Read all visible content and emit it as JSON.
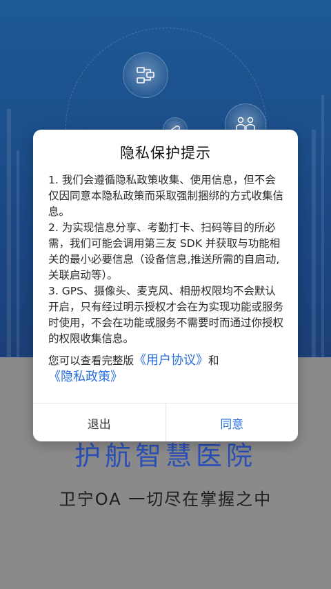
{
  "app": {
    "hospital_name": "护航智慧医院",
    "slogan": "卫宁OA  一切尽在掌握之中"
  },
  "icons": {
    "top_bubble": "workflow-icon",
    "right_bubble": "people-icon",
    "small_bubble": "capsule-icon"
  },
  "dialog": {
    "title": "隐私保护提示",
    "paragraphs": [
      "1. 我们会遵循隐私政策收集、使用信息，但不会仅因同意本隐私政策而采取强制捆绑的方式收集信息。",
      "2. 为实现信息分享、考勤打卡、扫码等目的所必需，我们可能会调用第三友 SDK 并获取与功能相关的最小必要信息（设备信息,推送所需的自启动,关联启动等）。",
      "3. GPS、摄像头、麦克风、相册权限均不会默认开启，只有经过明示授权才会在为实现功能或服务时使用，不会在功能或服务不需要时而通过你授权的权限收集信息。"
    ],
    "links_prefix": "您可以查看完整版",
    "user_agreement": "《用户协议》",
    "connector": "和",
    "privacy_policy": "《隐私政策》",
    "exit_label": "退出",
    "agree_label": "同意"
  },
  "colors": {
    "accent": "#2a6fdb",
    "background_top": "#1d5a97",
    "overlay": "#8a8a8a",
    "hospital_name": "#2a4fb6"
  }
}
